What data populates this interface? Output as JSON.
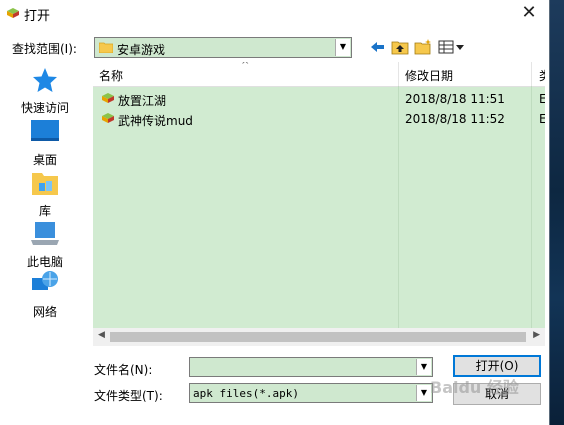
{
  "window": {
    "title": "打开",
    "close_symbol": "✕"
  },
  "look_in": {
    "label": "查找范围(I):",
    "value": "安卓游戏"
  },
  "places": [
    {
      "label": "快速访问",
      "icon": "star-icon"
    },
    {
      "label": "桌面",
      "icon": "desktop-icon"
    },
    {
      "label": "库",
      "icon": "library-icon"
    },
    {
      "label": "此电脑",
      "icon": "computer-icon"
    },
    {
      "label": "网络",
      "icon": "network-icon"
    }
  ],
  "list": {
    "columns": [
      "名称",
      "修改日期",
      "类"
    ],
    "rows": [
      {
        "name": "放置江湖",
        "date": "2018/8/18 11:51",
        "type": "E"
      },
      {
        "name": "武神传说mud",
        "date": "2018/8/18 11:52",
        "type": "E"
      }
    ]
  },
  "file_name": {
    "label": "文件名(N):",
    "value": ""
  },
  "file_type": {
    "label": "文件类型(T):",
    "value": "apk files(*.apk)"
  },
  "buttons": {
    "open": "打开(O)",
    "cancel": "取消"
  },
  "watermark": "Baidu 经验",
  "colors": {
    "selection_green": "#d1ebd1",
    "accent": "#0078d7"
  }
}
